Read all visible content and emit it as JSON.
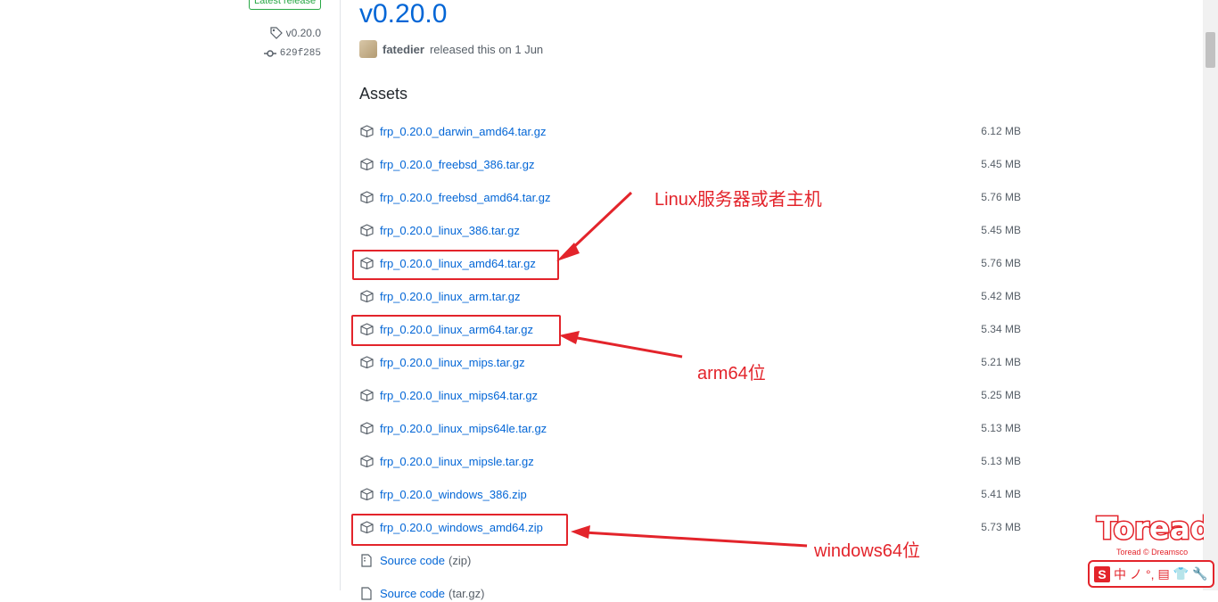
{
  "sidebar": {
    "badge": "Latest release",
    "tag": "v0.20.0",
    "commit": "629f285"
  },
  "release": {
    "title": "v0.20.0",
    "author": "fatedier",
    "released_text": "released this on 1 Jun"
  },
  "assets": {
    "heading": "Assets",
    "items": [
      {
        "name": "frp_0.20.0_darwin_amd64.tar.gz",
        "size": "6.12 MB"
      },
      {
        "name": "frp_0.20.0_freebsd_386.tar.gz",
        "size": "5.45 MB"
      },
      {
        "name": "frp_0.20.0_freebsd_amd64.tar.gz",
        "size": "5.76 MB"
      },
      {
        "name": "frp_0.20.0_linux_386.tar.gz",
        "size": "5.45 MB"
      },
      {
        "name": "frp_0.20.0_linux_amd64.tar.gz",
        "size": "5.76 MB"
      },
      {
        "name": "frp_0.20.0_linux_arm.tar.gz",
        "size": "5.42 MB"
      },
      {
        "name": "frp_0.20.0_linux_arm64.tar.gz",
        "size": "5.34 MB"
      },
      {
        "name": "frp_0.20.0_linux_mips.tar.gz",
        "size": "5.21 MB"
      },
      {
        "name": "frp_0.20.0_linux_mips64.tar.gz",
        "size": "5.25 MB"
      },
      {
        "name": "frp_0.20.0_linux_mips64le.tar.gz",
        "size": "5.13 MB"
      },
      {
        "name": "frp_0.20.0_linux_mipsle.tar.gz",
        "size": "5.13 MB"
      },
      {
        "name": "frp_0.20.0_windows_386.zip",
        "size": "5.41 MB"
      },
      {
        "name": "frp_0.20.0_windows_amd64.zip",
        "size": "5.73 MB"
      }
    ],
    "source_zip": {
      "label": "Source code",
      "ext": "(zip)"
    },
    "source_tar": {
      "label": "Source code",
      "ext": "(tar.gz)"
    }
  },
  "annotations": {
    "linux": "Linux服务器或者主机",
    "arm64": "arm64位",
    "windows64": "windows64位"
  },
  "overlay": {
    "logo_text": "Toread",
    "logo_sub": "Toread © Dreamsco",
    "ime_items": [
      "S",
      "中",
      "ノ",
      "°,",
      "▤",
      "👕",
      "🔧"
    ]
  },
  "colors": {
    "link": "#0366d6",
    "annotation": "#e3242b",
    "badge": "#28a745"
  }
}
